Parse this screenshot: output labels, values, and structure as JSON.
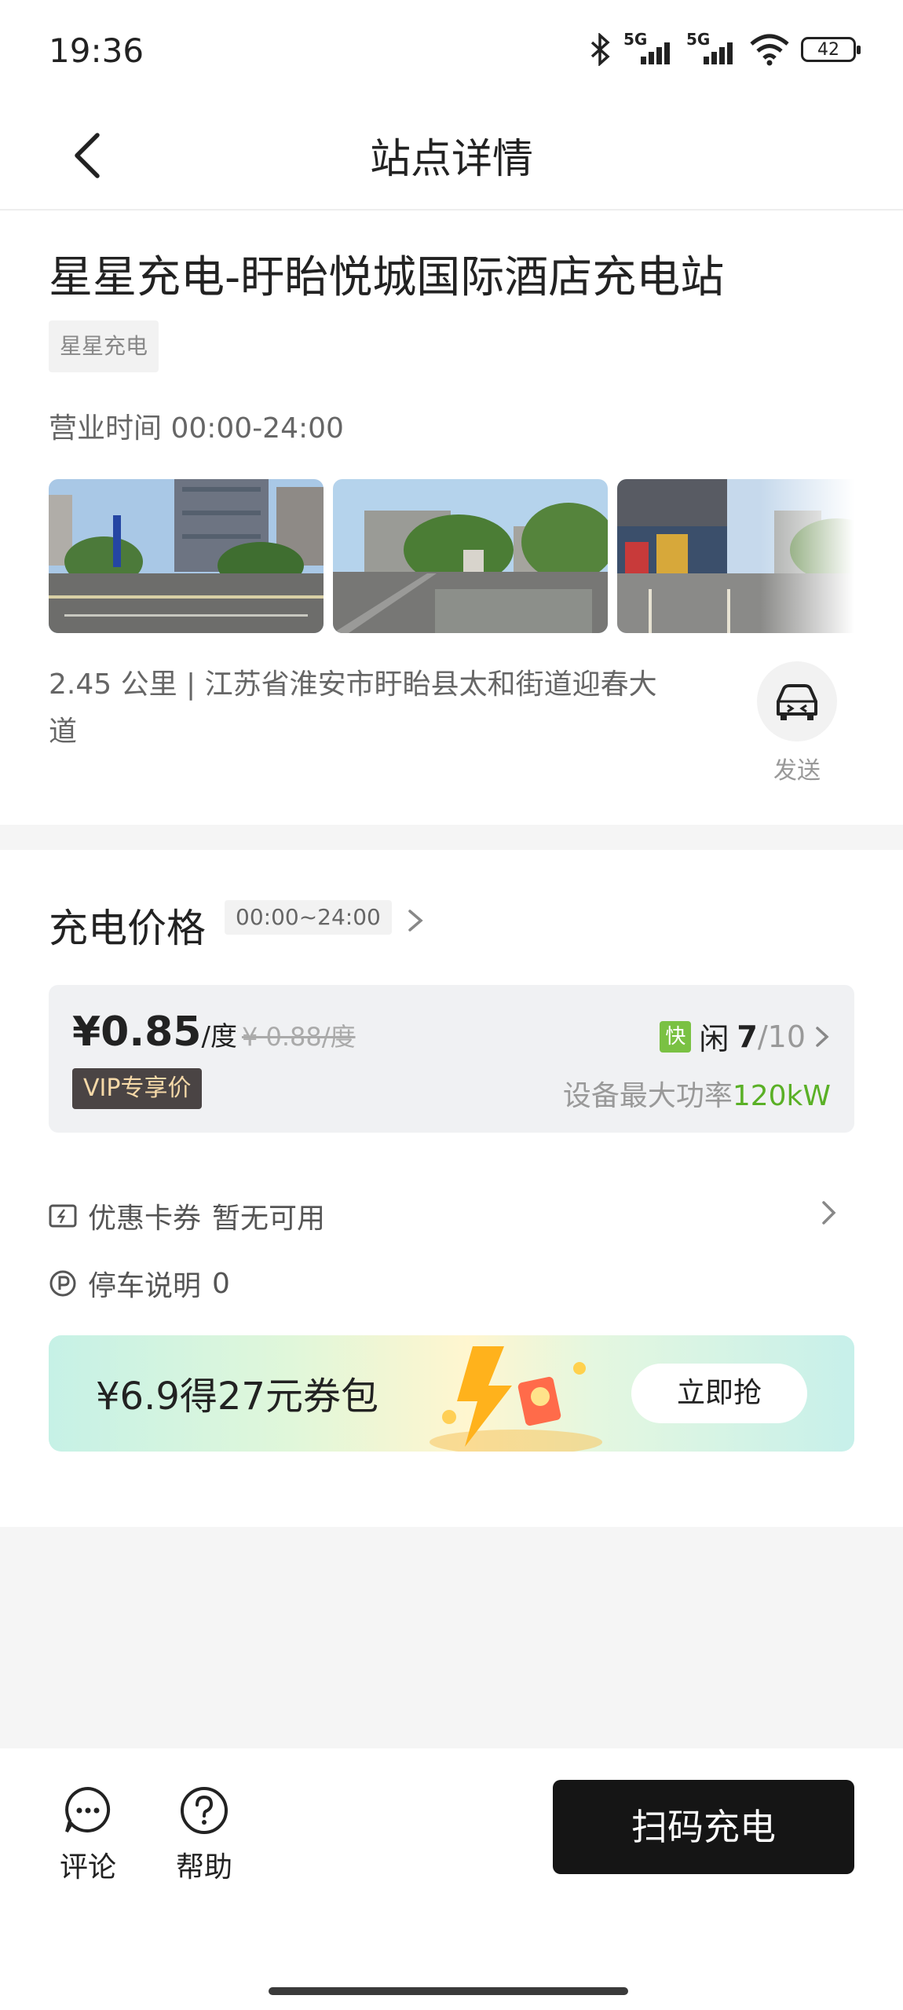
{
  "status": {
    "time": "19:36",
    "sig1": "5G",
    "sig2": "5G",
    "battery": "42"
  },
  "nav": {
    "title": "站点详情"
  },
  "station": {
    "name": "星星充电-盱眙悦城国际酒店充电站",
    "brand": "星星充电",
    "hours": "营业时间 00:00-24:00",
    "address": "2.45 公里 | 江苏省淮安市盱眙县太和街道迎春大道",
    "send_label": "发送"
  },
  "price": {
    "title": "充电价格",
    "period": "00:00~24:00",
    "amount": "¥0.85",
    "unit": "/度",
    "original": "¥ 0.88/度",
    "vip": "VIP专享价",
    "fast_badge": "快",
    "idle_label": "闲",
    "idle_count": "7",
    "total": "/10",
    "power_label": "设备最大功率",
    "power_value": "120kW"
  },
  "coupon": {
    "label": "优惠卡券",
    "value": "暂无可用"
  },
  "parking": {
    "label": "停车说明",
    "value": "0"
  },
  "banner": {
    "text": "¥6.9得27元券包",
    "button": "立即抢"
  },
  "bottom": {
    "comment": "评论",
    "help": "帮助",
    "scan": "扫码充电"
  },
  "colors": {
    "accent_green": "#5ab026",
    "button_dark": "#151515",
    "vip_bg": "#4a4444"
  }
}
